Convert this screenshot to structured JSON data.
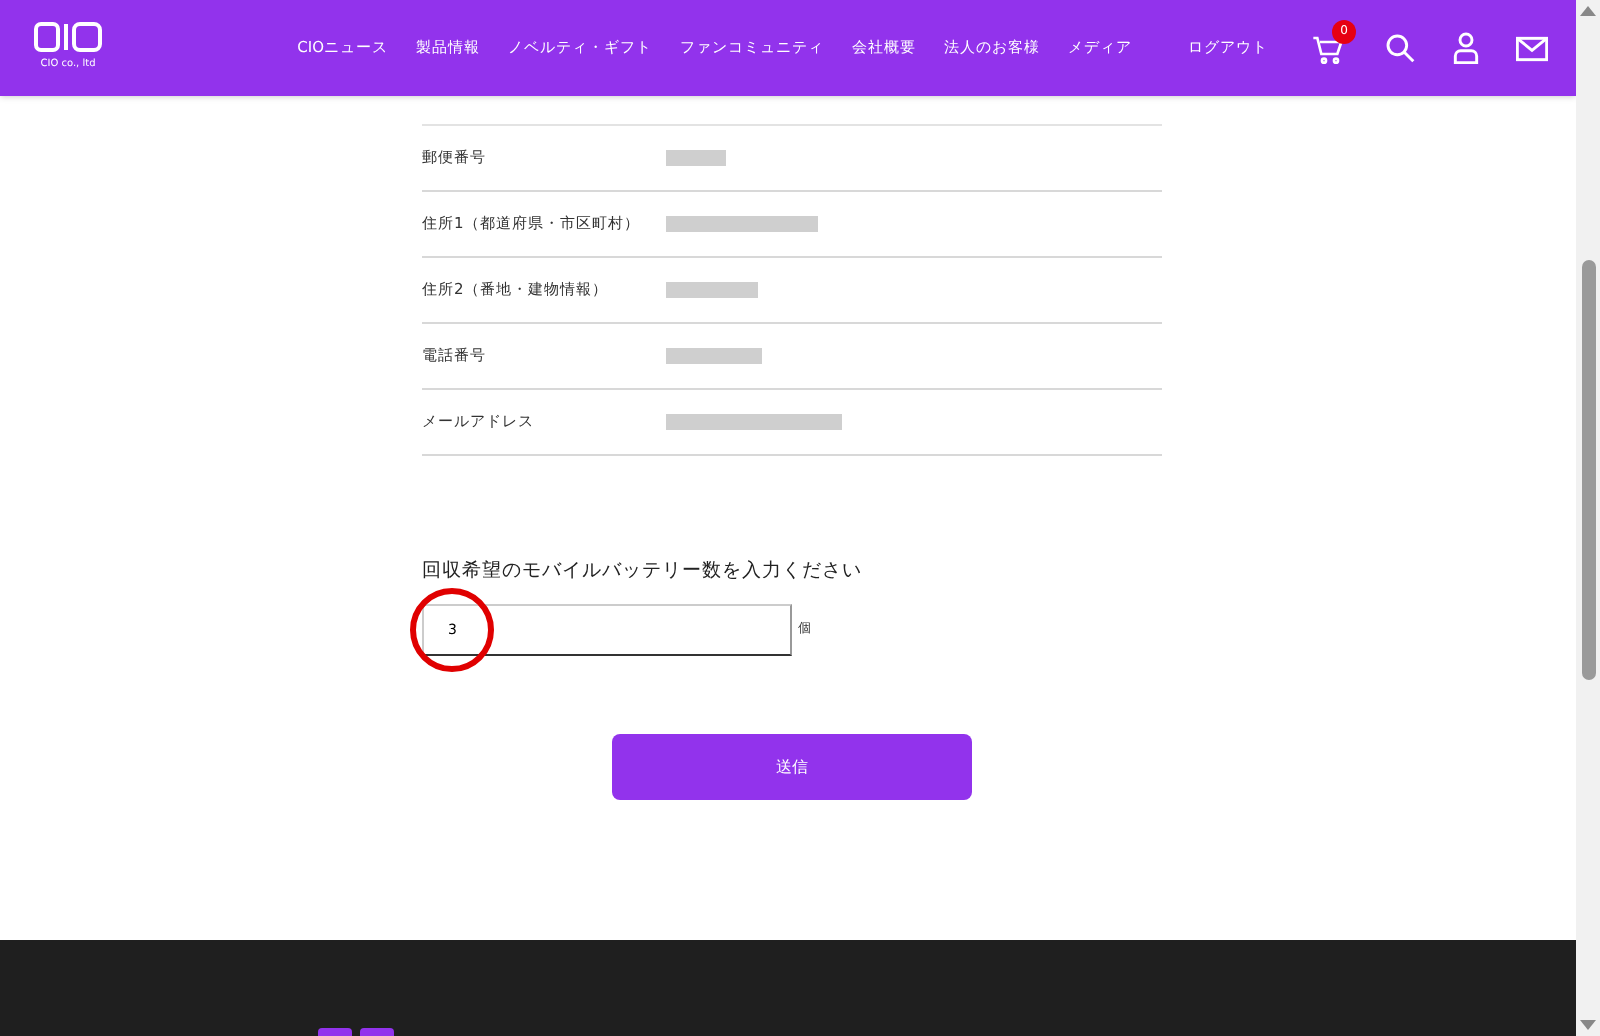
{
  "header": {
    "logo_caption": "CIO co., ltd",
    "nav": [
      "CIOニュース",
      "製品情報",
      "ノベルティ・ギフト",
      "ファンコミュニティ",
      "会社概要",
      "法人のお客様",
      "メディア"
    ],
    "logout": "ログアウト",
    "cart_count": "0"
  },
  "fields": [
    {
      "label": "郵便番号"
    },
    {
      "label": "住所1（都道府県・市区町村）"
    },
    {
      "label": "住所2（番地・建物情報）"
    },
    {
      "label": "電話番号"
    },
    {
      "label": "メールアドレス"
    }
  ],
  "quantity": {
    "question": "回収希望のモバイルバッテリー数を入力ください",
    "value": "3",
    "unit": "個"
  },
  "submit": "送信"
}
